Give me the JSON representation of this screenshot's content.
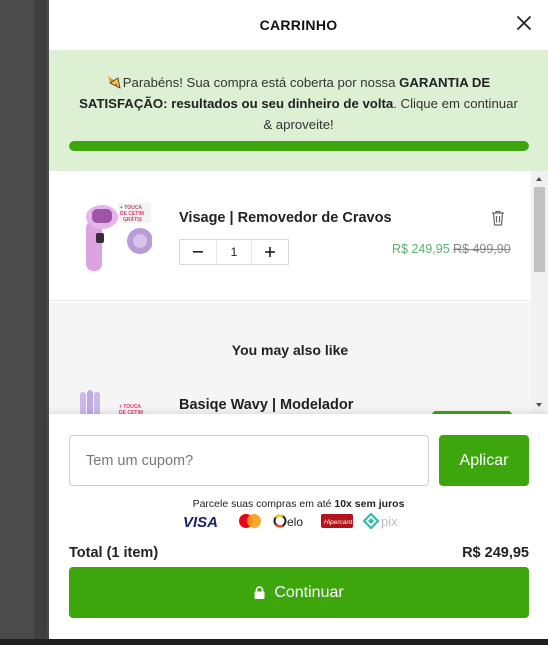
{
  "cart": {
    "title": "CARRINHO",
    "banner": {
      "icon": "medal-icon",
      "text_intro": "Parabéns! Sua compra está coberta por nossa ",
      "text_bold": "GARANTIA DE SATISFAÇÃO: resultados ou seu dinheiro de volta",
      "text_outro": ". Clique em continuar & aproveite!",
      "progress_fraction": 1.0
    },
    "items": [
      {
        "name": "Visage | Removedor de Cravos",
        "quantity": "1",
        "price": "R$ 249,95",
        "old_price": "R$ 499,90",
        "thumb_badge": "TOUCA DE CETIM GRÁTIS"
      }
    ],
    "upsell": {
      "title": "You may also like",
      "items": [
        {
          "name": "Basiqe Wavy | Modelador",
          "thumb_badge": "TOUCA DE CETIM"
        }
      ]
    },
    "coupon": {
      "placeholder": "Tem um cupom?",
      "apply_label": "Aplicar"
    },
    "installments": {
      "prefix": "Parcele suas compras em até ",
      "bold": "10x sem juros"
    },
    "payment_methods": [
      "VISA",
      "mastercard",
      "elo",
      "Hipercard",
      "pix"
    ],
    "total": {
      "label": "Total (1 item)",
      "value": "R$ 249,95"
    },
    "continue_label": "Continuar",
    "colors": {
      "accent": "#3ea60d",
      "banner_bg": "#ddf0d4",
      "sale_price": "#5bb16a"
    }
  }
}
